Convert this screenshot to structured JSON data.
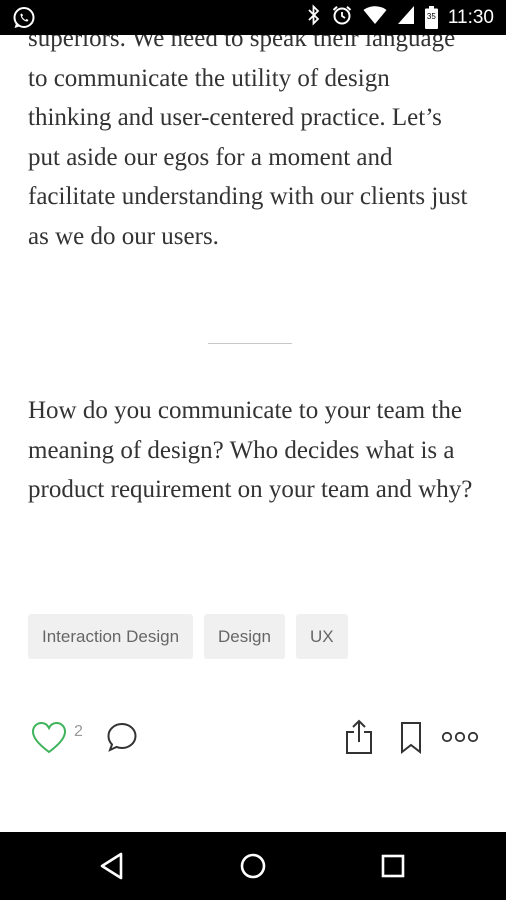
{
  "status_bar": {
    "time": "11:30",
    "battery_level": "35",
    "icons": [
      "whatsapp-icon",
      "bluetooth-icon",
      "alarm-icon",
      "wifi-icon",
      "signal-icon",
      "battery-icon"
    ]
  },
  "article": {
    "paragraph_top": "superiors. We need to speak their language to communicate the utility of design thinking and user-centered practice. Let’s put aside our egos for a moment and facilitate understanding with our clients just as we do our users.",
    "paragraph_bottom": "How do you communicate to your team the meaning of design? Who decides what is a product requirement on your team and why?"
  },
  "tags": [
    "Interaction Design",
    "Design",
    "UX"
  ],
  "actions": {
    "like_count": "2",
    "like_color": "#3db35a",
    "icon_color": "#333333",
    "icons": [
      "heart-icon",
      "comment-icon",
      "share-icon",
      "bookmark-icon",
      "more-icon"
    ]
  },
  "nav_bar": {
    "icons": [
      "back-icon",
      "home-icon",
      "recents-icon"
    ]
  }
}
